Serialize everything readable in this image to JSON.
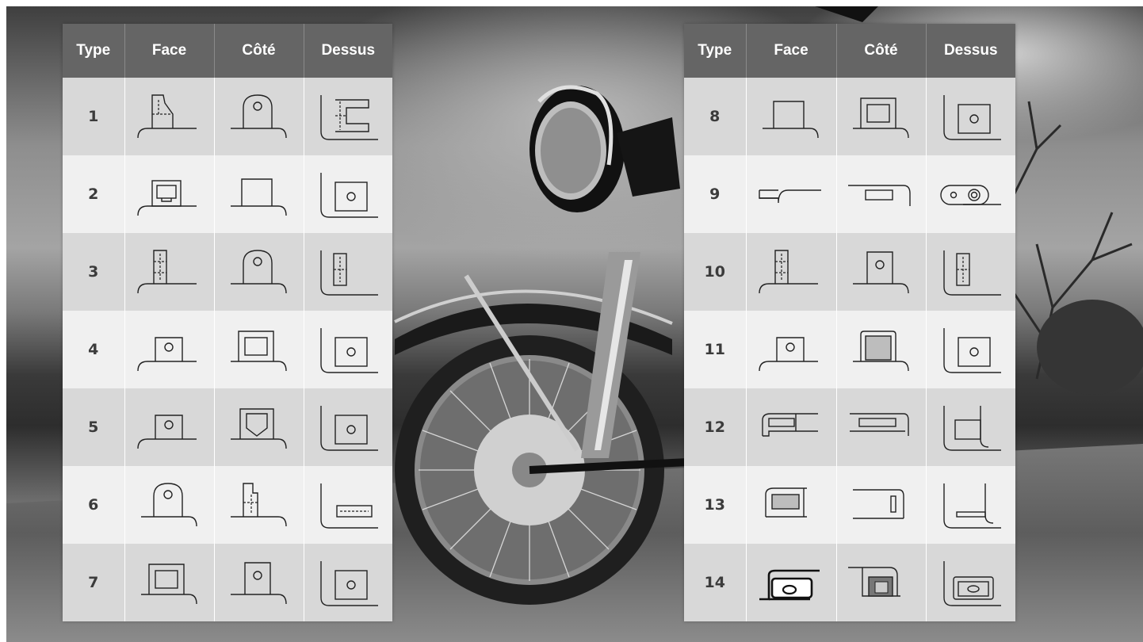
{
  "headers": {
    "type": "Type",
    "face": "Face",
    "side": "Côté",
    "top": "Dessus"
  },
  "left_rows": [
    {
      "type": "1",
      "face": "tab-chamfer-dashed-icon",
      "side": "rounded-tab-hole-icon",
      "top": "corner-bracket-dashed-icon"
    },
    {
      "type": "2",
      "face": "tab-square-slot-icon",
      "side": "plain-tab-icon",
      "top": "corner-square-hole-icon"
    },
    {
      "type": "3",
      "face": "tall-tab-dashed-icon",
      "side": "rounded-tab-hole-icon",
      "top": "corner-dashed-slot-icon"
    },
    {
      "type": "4",
      "face": "tab-hole-icon",
      "side": "tab-window-icon",
      "top": "corner-square-hole-icon"
    },
    {
      "type": "5",
      "face": "tab-hole-icon",
      "side": "tab-pentagon-window-icon",
      "top": "corner-square-hole-icon"
    },
    {
      "type": "6",
      "face": "rounded-tab-hole-icon",
      "side": "stepped-tab-dashed-icon",
      "top": "corner-flat-slot-icon"
    },
    {
      "type": "7",
      "face": "tab-window-icon",
      "side": "tall-tab-hole-icon",
      "top": "corner-square-hole-icon"
    }
  ],
  "right_rows": [
    {
      "type": "8",
      "face": "plain-tab-icon",
      "side": "tab-window-icon",
      "top": "corner-square-hole-icon"
    },
    {
      "type": "9",
      "face": "thin-flange-icon",
      "side": "flat-slot-flange-icon",
      "top": "double-hole-tab-icon"
    },
    {
      "type": "10",
      "face": "tall-tab-dashed-icon",
      "side": "tall-tab-hole-icon",
      "top": "corner-dashed-slot-icon"
    },
    {
      "type": "11",
      "face": "tab-hole-icon",
      "side": "tab-filled-window-icon",
      "top": "corner-square-hole-icon"
    },
    {
      "type": "12",
      "face": "flange-slot-icon",
      "side": "flange-long-slot-icon",
      "top": "corner-block-icon"
    },
    {
      "type": "13",
      "face": "flange-filled-slot-icon",
      "side": "flange-end-slot-icon",
      "top": "corner-low-slot-icon"
    },
    {
      "type": "14",
      "face": "heavy-tab-oval-icon",
      "side": "mesh-tab-icon",
      "top": "corner-oval-window-icon"
    }
  ],
  "colors": {
    "header_bg": "#656565",
    "row_dark": "#d8d8d8",
    "row_light": "#f0f0f0",
    "icon_stroke": "#222222"
  }
}
